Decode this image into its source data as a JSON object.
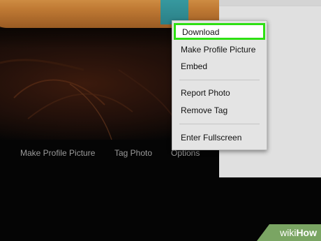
{
  "photo_actions": [
    {
      "label": "Make Profile Picture"
    },
    {
      "label": "Tag Photo"
    },
    {
      "label": "Options"
    }
  ],
  "context_menu": {
    "group1": [
      "Download",
      "Make Profile Picture",
      "Embed"
    ],
    "group2": [
      "Report Photo",
      "Remove Tag"
    ],
    "group3": [
      "Enter Fullscreen"
    ],
    "highlight_color": "#2ee013"
  },
  "watermark": {
    "wiki": "wiki",
    "how": "How"
  },
  "colors": {
    "photo_background": "#000000",
    "side_panel": "#e0e0e0",
    "menu_background": "#e4e4e4"
  }
}
